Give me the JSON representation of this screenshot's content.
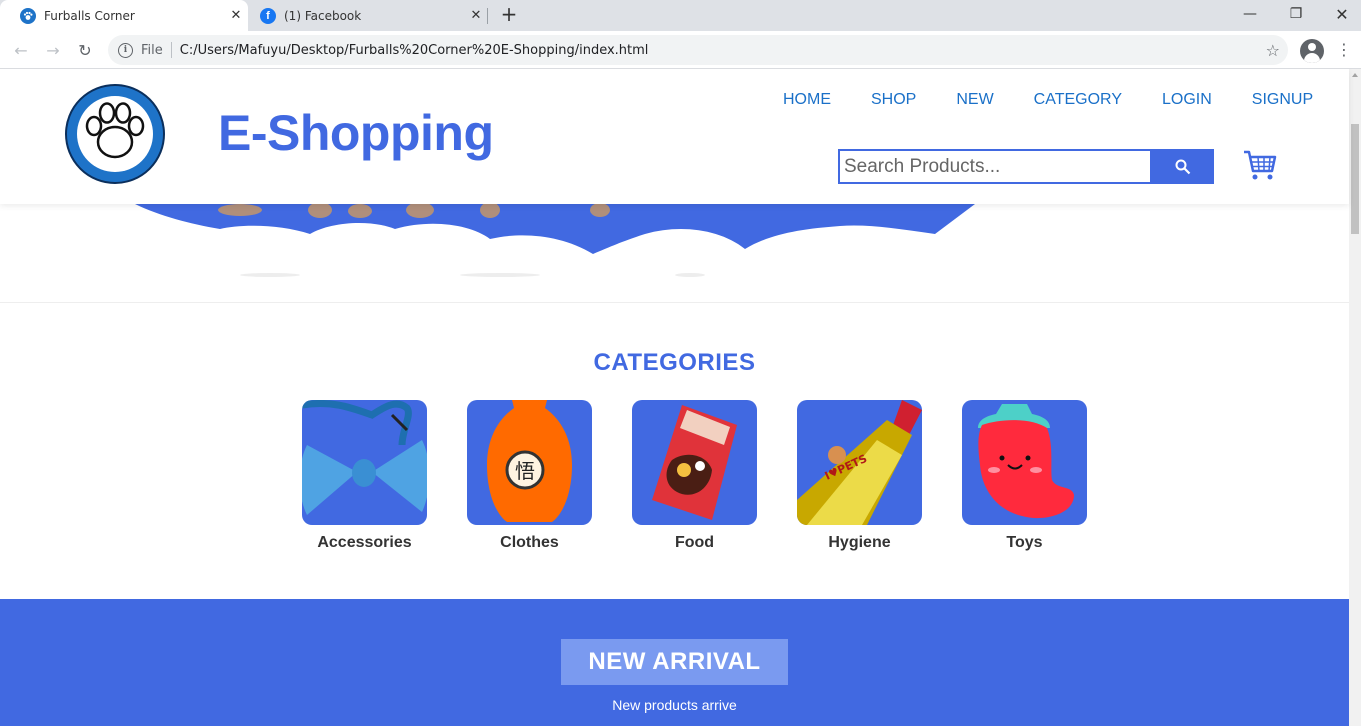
{
  "browser": {
    "tabs": [
      {
        "title": "Furballs Corner",
        "active": true
      },
      {
        "title": "(1) Facebook",
        "active": false
      }
    ],
    "address": {
      "scheme_label": "File",
      "url": "C:/Users/Mafuyu/Desktop/Furballs%20Corner%20E-Shopping/index.html"
    }
  },
  "header": {
    "logo_text": "Furballs Corner",
    "brand": "E-Shopping",
    "nav": [
      "HOME",
      "SHOP",
      "NEW",
      "CATEGORY",
      "LOGIN",
      "SIGNUP"
    ],
    "search_placeholder": "Search Products..."
  },
  "categories": {
    "title": "CATEGORIES",
    "items": [
      {
        "label": "Accessories",
        "icon": "bow-tie-icon"
      },
      {
        "label": "Clothes",
        "icon": "pet-shirt-icon"
      },
      {
        "label": "Food",
        "icon": "treat-bag-icon"
      },
      {
        "label": "Hygiene",
        "icon": "cologne-bottle-icon"
      },
      {
        "label": "Toys",
        "icon": "chili-toy-icon"
      }
    ]
  },
  "new_arrival": {
    "title": "NEW ARRIVAL",
    "subtitle": "New products arrive"
  },
  "colors": {
    "brand": "#4169e1",
    "nav": "#1a70c8",
    "new_arrival_box": "#7a9af0"
  }
}
